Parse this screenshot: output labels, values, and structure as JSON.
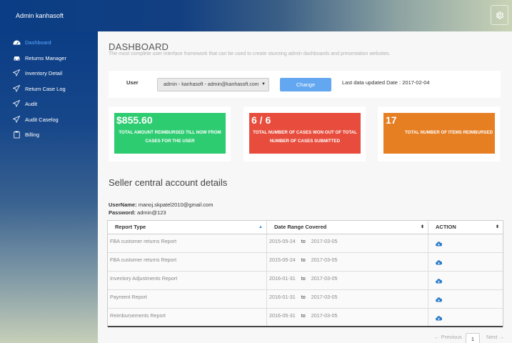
{
  "app": {
    "brand": "Admin kanhasoft"
  },
  "sidebar": {
    "items": [
      {
        "label": "Dashboard",
        "icon": "dashboard-icon",
        "active": true
      },
      {
        "label": "Returns Manager",
        "icon": "car-icon"
      },
      {
        "label": "Inventory Detail",
        "icon": "paper-plane-icon"
      },
      {
        "label": "Return Case Log",
        "icon": "paper-plane-icon"
      },
      {
        "label": "Audit",
        "icon": "paper-plane-icon"
      },
      {
        "label": "Audit Caselog",
        "icon": "paper-plane-icon"
      },
      {
        "label": "Billing",
        "icon": "clipboard-icon"
      }
    ]
  },
  "header": {
    "title": "DASHBOARD",
    "subtitle": "The most complete user interface framework that can be used to create stunning admin dashboards and presentation websites."
  },
  "user_bar": {
    "label": "User",
    "selected": "admin - kanhasoft - admin@kanhasoft.com",
    "change_label": "Change",
    "last_update": "Last data updated Date : 2017-02-04"
  },
  "cards": [
    {
      "value": "$855.60",
      "desc_line1": "TOTAL AMOUNT REIMBURSED TILL NOW FROM",
      "desc_line2": "CASES FOR THE USER",
      "color": "#2ecc71"
    },
    {
      "value": "6 / 6",
      "desc_line1": "TOTAL NUMBER OF CASES WON OUT OF TOTAL",
      "desc_line2": "NUMBER OF CASES SUBMITTED",
      "color": "#e74c3c"
    },
    {
      "value": "17",
      "desc_line1": "TOTAL NUMBER OF ITEMS REIMBURSED",
      "desc_line2": "",
      "color": "#e67e22"
    }
  ],
  "account": {
    "title": "Seller central account details",
    "username_label": "UserName:",
    "username": "manoj.skpatel2010@gmail.com",
    "password_label": "Password:",
    "password": "admin@123"
  },
  "table": {
    "headers": [
      "Report Type",
      "Date Range Covered",
      "ACTION"
    ],
    "to_label": "to",
    "rows": [
      {
        "type": "FBA customer returns Report",
        "from": "2015-05-24",
        "to": "2017-03-05"
      },
      {
        "type": "FBA customer returns Report",
        "from": "2015-05-24",
        "to": "2017-03-05"
      },
      {
        "type": "Inventory Adjustments Report",
        "from": "2016-01-31",
        "to": "2017-03-05"
      },
      {
        "type": "Payment Report",
        "from": "2016-01-31",
        "to": "2017-03-05"
      },
      {
        "type": "Reimbursements Report",
        "from": "2016-05-31",
        "to": "2017-03-05"
      }
    ]
  },
  "pagination": {
    "previous": "← Previous",
    "page": "1",
    "next": "Next →"
  },
  "colors": {
    "accent": "#62a7f0",
    "sidebar_active": "#5aa8ff"
  }
}
